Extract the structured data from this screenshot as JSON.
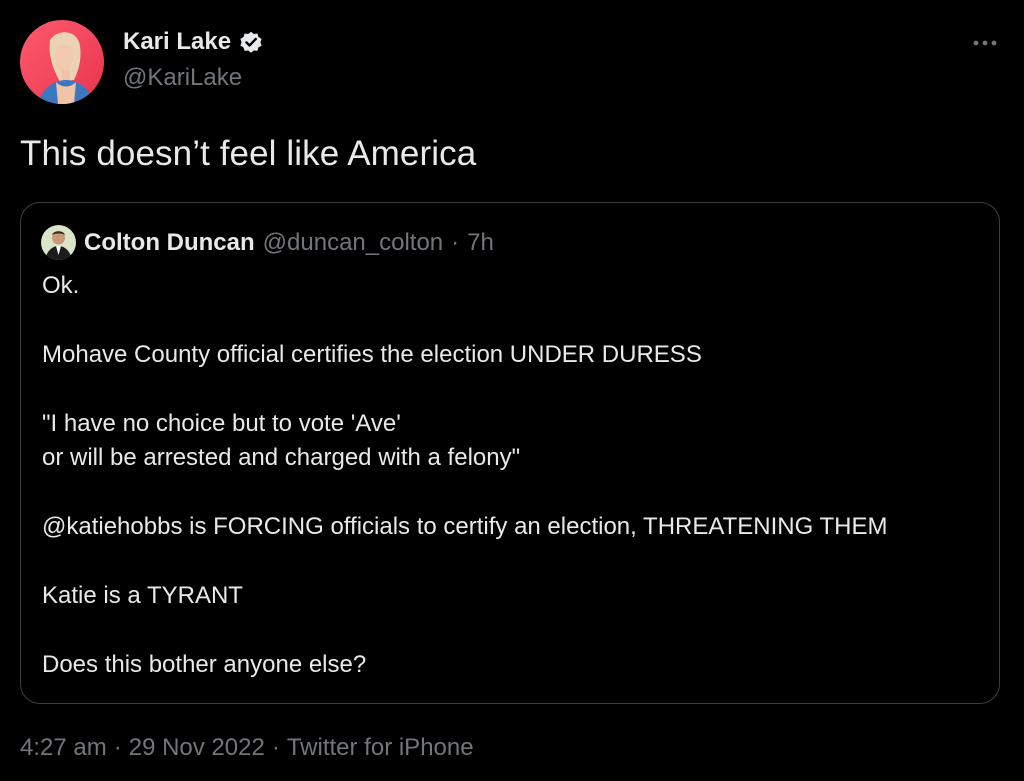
{
  "author": {
    "display_name": "Kari Lake",
    "handle": "@KariLake",
    "verified": true,
    "avatar_icon": "profile-photo"
  },
  "menu": {
    "icon": "more-horizontal-icon"
  },
  "tweet": {
    "text": "This doesn’t feel like America"
  },
  "quoted": {
    "display_name": "Colton Duncan",
    "handle": "@duncan_colton",
    "separator": "·",
    "time": "7h",
    "lines": [
      "Ok.",
      "",
      "Mohave County official certifies the election UNDER DURESS",
      "",
      "\"I have no choice but to vote 'Ave'",
      "or will be arrested and charged with a felony\"",
      "",
      "@katiehobbs is FORCING officials to certify an election, THREATENING THEM",
      "",
      "Katie is a TYRANT",
      "",
      "Does this bother anyone else?"
    ]
  },
  "meta": {
    "time": "4:27 am",
    "sep1": "·",
    "date": "29 Nov 2022",
    "sep2": "·",
    "source": "Twitter for iPhone"
  },
  "colors": {
    "background": "#000000",
    "text": "#e7e9ea",
    "secondary": "#71767b",
    "border": "#3c3f42",
    "verified_badge": "#e7e9ea"
  }
}
